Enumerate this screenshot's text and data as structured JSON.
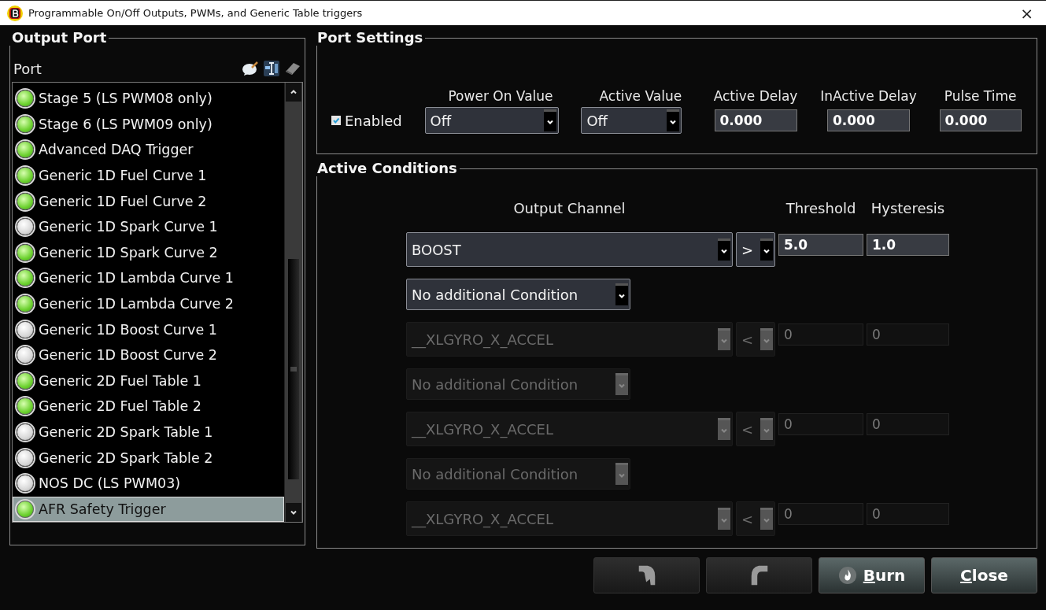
{
  "window": {
    "title": "Programmable On/Off Outputs, PWMs, and Generic Table triggers",
    "close": "×"
  },
  "output_port": {
    "title": "Output Port",
    "column_label": "Port",
    "ports": [
      {
        "label": "Stage 5 (LS PWM08 only)",
        "active": true,
        "selected": false
      },
      {
        "label": "Stage 6 (LS PWM09 only)",
        "active": true,
        "selected": false
      },
      {
        "label": "Advanced DAQ Trigger",
        "active": true,
        "selected": false
      },
      {
        "label": "Generic 1D Fuel Curve 1",
        "active": true,
        "selected": false
      },
      {
        "label": "Generic 1D Fuel Curve 2",
        "active": true,
        "selected": false
      },
      {
        "label": "Generic 1D Spark Curve 1",
        "active": false,
        "selected": false
      },
      {
        "label": "Generic 1D Spark Curve 2",
        "active": true,
        "selected": false
      },
      {
        "label": "Generic 1D Lambda Curve 1",
        "active": true,
        "selected": false
      },
      {
        "label": "Generic 1D Lambda Curve 2",
        "active": true,
        "selected": false
      },
      {
        "label": "Generic 1D Boost Curve 1",
        "active": false,
        "selected": false
      },
      {
        "label": "Generic 1D Boost Curve 2",
        "active": false,
        "selected": false
      },
      {
        "label": "Generic 2D Fuel Table 1",
        "active": true,
        "selected": false
      },
      {
        "label": "Generic 2D Fuel Table 2",
        "active": true,
        "selected": false
      },
      {
        "label": "Generic 2D Spark Table 1",
        "active": false,
        "selected": false
      },
      {
        "label": "Generic 2D Spark Table 2",
        "active": false,
        "selected": false
      },
      {
        "label": "NOS DC (LS PWM03)",
        "active": false,
        "selected": false
      },
      {
        "label": "AFR Safety Trigger",
        "active": true,
        "selected": true
      }
    ]
  },
  "port_settings": {
    "title": "Port Settings",
    "enabled": {
      "label": "Enabled",
      "checked": true
    },
    "power_on_value": {
      "label": "Power On Value",
      "value": "Off"
    },
    "active_value": {
      "label": "Active Value",
      "value": "Off"
    },
    "active_delay": {
      "label": "Active Delay",
      "value": "0.000"
    },
    "inactive_delay": {
      "label": "InActive Delay",
      "value": "0.000"
    },
    "pulse_time": {
      "label": "Pulse Time",
      "value": "0.000"
    }
  },
  "active_conditions": {
    "title": "Active Conditions",
    "headers": [
      "Output Channel",
      "Threshold",
      "Hysteresis"
    ],
    "rows": [
      {
        "kind": "condition",
        "channel": "BOOST",
        "operator": ">",
        "threshold": "5.0",
        "hysteresis": "1.0",
        "disabled": false
      },
      {
        "kind": "connector",
        "value": "No additional Condition",
        "disabled": false
      },
      {
        "kind": "condition",
        "channel": "__XLGYRO_X_ACCEL",
        "operator": "<",
        "threshold": "0",
        "hysteresis": "0",
        "disabled": true
      },
      {
        "kind": "connector",
        "value": "No additional Condition",
        "disabled": true
      },
      {
        "kind": "condition",
        "channel": "__XLGYRO_X_ACCEL",
        "operator": "<",
        "threshold": "0",
        "hysteresis": "0",
        "disabled": true
      },
      {
        "kind": "connector",
        "value": "No additional Condition",
        "disabled": true
      },
      {
        "kind": "condition",
        "channel": "__XLGYRO_X_ACCEL",
        "operator": "<",
        "threshold": "0",
        "hysteresis": "0",
        "disabled": true
      }
    ]
  },
  "buttons": [
    {
      "kind": "undo",
      "disabled": true
    },
    {
      "kind": "redo",
      "disabled": true
    },
    {
      "kind": "burn",
      "label": "Burn",
      "mnemonic_underlined": true,
      "disabled": false
    },
    {
      "kind": "close",
      "label": "Close",
      "mnemonic_underlined": true,
      "disabled": false
    }
  ]
}
